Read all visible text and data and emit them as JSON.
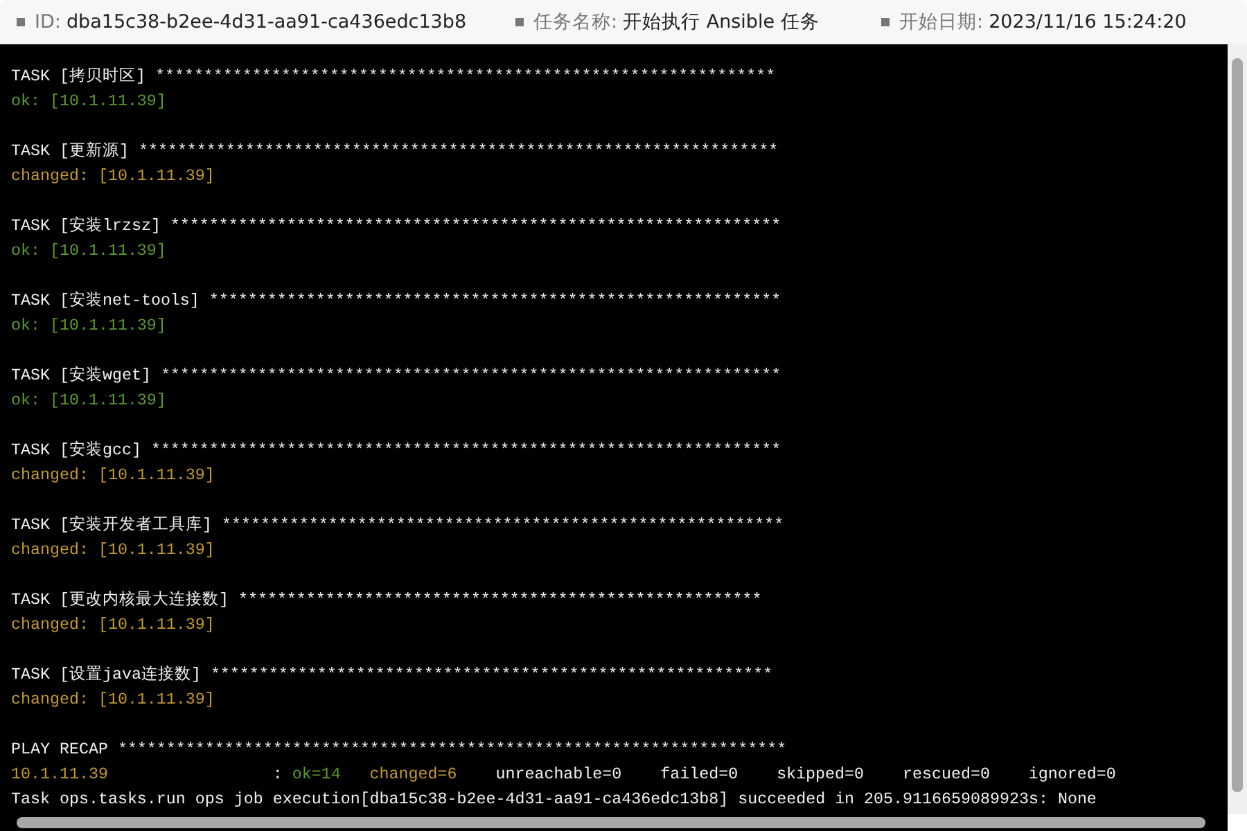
{
  "header": [
    {
      "label": "ID:",
      "value": "dba15c38-b2ee-4d31-aa91-ca436edc13b8"
    },
    {
      "label": "任务名称:",
      "value": "开始执行 Ansible 任务"
    },
    {
      "label": "开始日期:",
      "value": "2023/11/16 15:24:20"
    }
  ],
  "tasks": [
    {
      "title": "TASK [拷贝时区] ****************************************************************",
      "result": "ok: [10.1.11.39]",
      "kind": "ok"
    },
    {
      "title": "TASK [更新源] ******************************************************************",
      "result": "changed: [10.1.11.39]",
      "kind": "changed"
    },
    {
      "title": "TASK [安装lrzsz] ***************************************************************",
      "result": "ok: [10.1.11.39]",
      "kind": "ok"
    },
    {
      "title": "TASK [安装net-tools] ***********************************************************",
      "result": "ok: [10.1.11.39]",
      "kind": "ok"
    },
    {
      "title": "TASK [安装wget] ****************************************************************",
      "result": "ok: [10.1.11.39]",
      "kind": "ok"
    },
    {
      "title": "TASK [安装gcc] *****************************************************************",
      "result": "changed: [10.1.11.39]",
      "kind": "changed"
    },
    {
      "title": "TASK [安装开发者工具库] **********************************************************",
      "result": "changed: [10.1.11.39]",
      "kind": "changed"
    },
    {
      "title": "TASK [更改内核最大连接数] ******************************************************",
      "result": "changed: [10.1.11.39]",
      "kind": "changed"
    },
    {
      "title": "TASK [设置java连接数] **********************************************************",
      "result": "changed: [10.1.11.39]",
      "kind": "changed"
    }
  ],
  "recap": {
    "title": "PLAY RECAP *********************************************************************",
    "host": {
      "text": "10.1.11.39",
      "kind": "changed"
    },
    "separator": ":",
    "counts": [
      {
        "text": "ok=14",
        "kind": "ok"
      },
      {
        "text": "changed=6",
        "kind": "changed"
      },
      {
        "text": "unreachable=0",
        "kind": "plain"
      },
      {
        "text": "failed=0",
        "kind": "plain"
      },
      {
        "text": "skipped=0",
        "kind": "plain"
      },
      {
        "text": "rescued=0",
        "kind": "plain"
      },
      {
        "text": "ignored=0",
        "kind": "plain"
      }
    ]
  },
  "final_line": "Task ops.tasks.run ops job execution[dba15c38-b2ee-4d31-aa91-ca436edc13b8] succeeded in 205.9116659089923s: None"
}
